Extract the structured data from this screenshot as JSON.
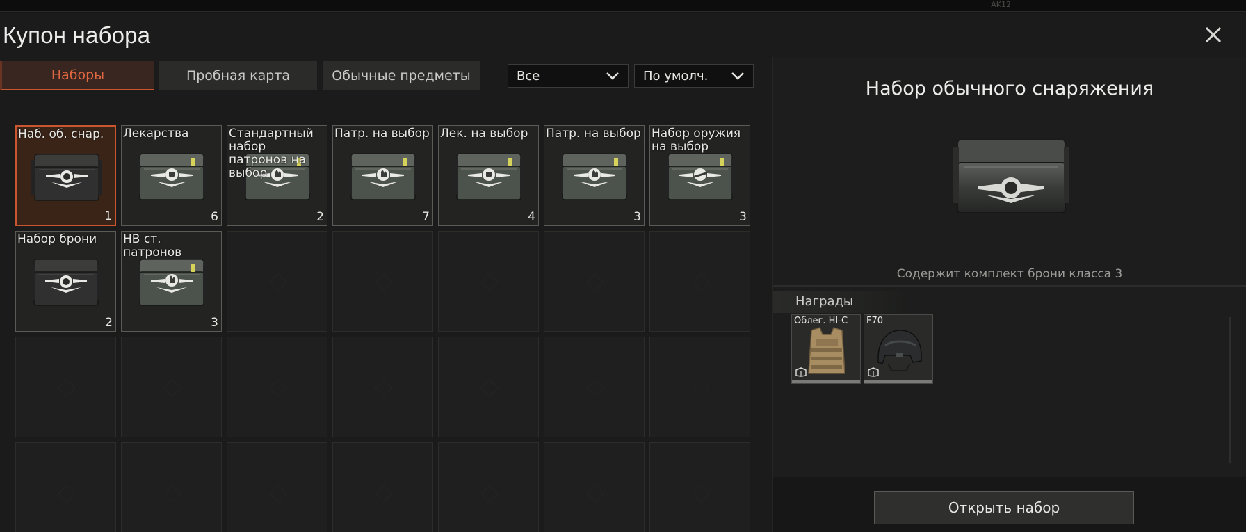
{
  "topbar": {
    "ghost_text": "AK12"
  },
  "window": {
    "title": "Купон набора"
  },
  "tabs": [
    {
      "label": "Наборы",
      "active": true
    },
    {
      "label": "Пробная карта",
      "active": false
    },
    {
      "label": "Обычные предметы",
      "active": false
    }
  ],
  "filters": {
    "category": "Все",
    "sort": "По умолч."
  },
  "items": [
    {
      "name": "Наб. об. снар.",
      "count": "1",
      "selected": true,
      "variant": "dark"
    },
    {
      "name": "Лекарства",
      "count": "6",
      "variant": "med"
    },
    {
      "name": "Стандартный набор патронов на выбор",
      "count": "2",
      "variant": "ammo"
    },
    {
      "name": "Патр. на выбор",
      "count": "7",
      "variant": "ammo"
    },
    {
      "name": "Лек. на выбор",
      "count": "4",
      "variant": "med"
    },
    {
      "name": "Патр. на выбор",
      "count": "3",
      "variant": "ammo"
    },
    {
      "name": "Набор оружия на выбор",
      "count": "3",
      "variant": "weapon"
    },
    {
      "name": "Набор брони",
      "count": "2",
      "variant": "dark"
    },
    {
      "name": "HB ст. патронов",
      "count": "3",
      "variant": "ammo"
    }
  ],
  "details": {
    "title": "Набор обычного снаряжения",
    "description": "Содержит комплект брони класса 3",
    "rewards_label": "Награды",
    "rewards": [
      {
        "name": "Облег. HI-C",
        "type": "vest-icon"
      },
      {
        "name": "F70",
        "type": "helmet-icon"
      }
    ],
    "open_button": "Открыть набор"
  },
  "colors": {
    "accent": "#c9562f",
    "accent_text": "#e06840",
    "background": "#1a1b1a"
  }
}
